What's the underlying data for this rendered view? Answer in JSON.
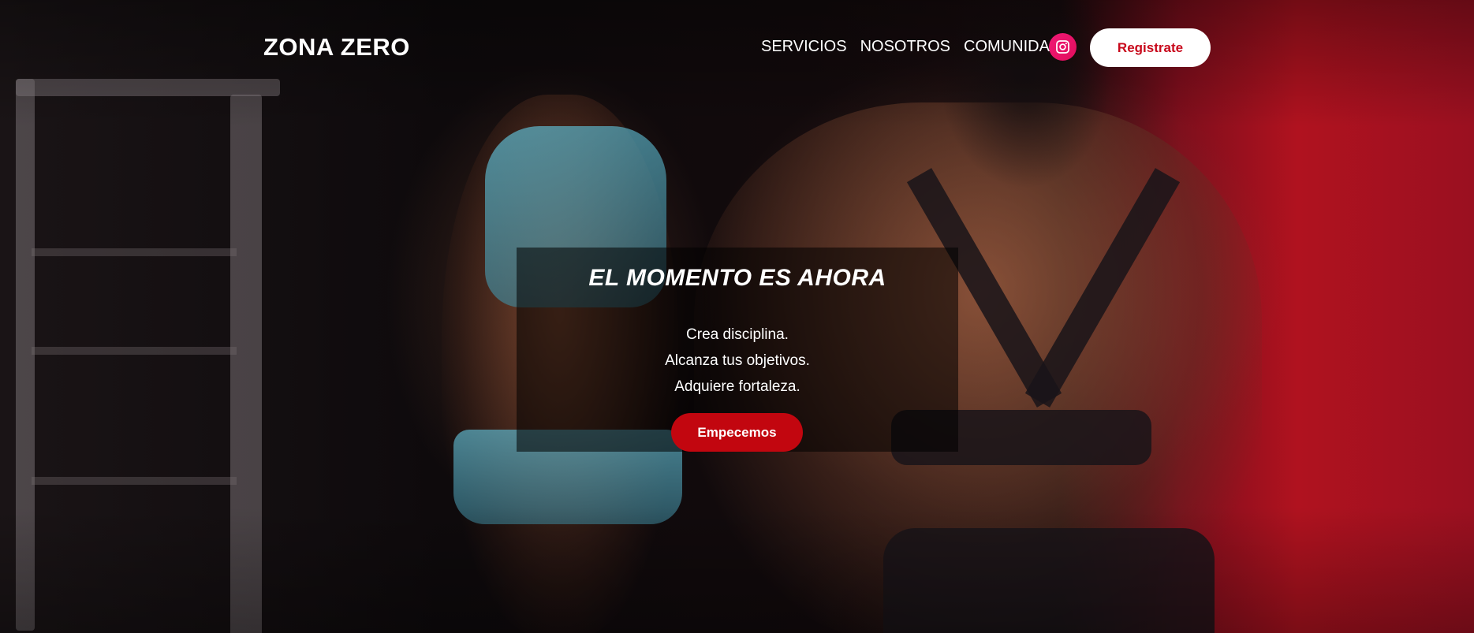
{
  "header": {
    "logo": "ZONA ZERO",
    "nav": [
      "SERVICIOS",
      "NOSOTROS",
      "COMUNIDAD"
    ],
    "social_icon": "instagram-icon",
    "register_label": "Registrate"
  },
  "hero": {
    "title": "EL MOMENTO ES AHORA",
    "lines": [
      "Crea disciplina.",
      "Alcanza tus objetivos.",
      "Adquiere fortaleza."
    ],
    "cta_label": "Empecemos"
  },
  "colors": {
    "accent": "#c2060f",
    "instagram": "#e10d5c",
    "text": "#ffffff"
  }
}
